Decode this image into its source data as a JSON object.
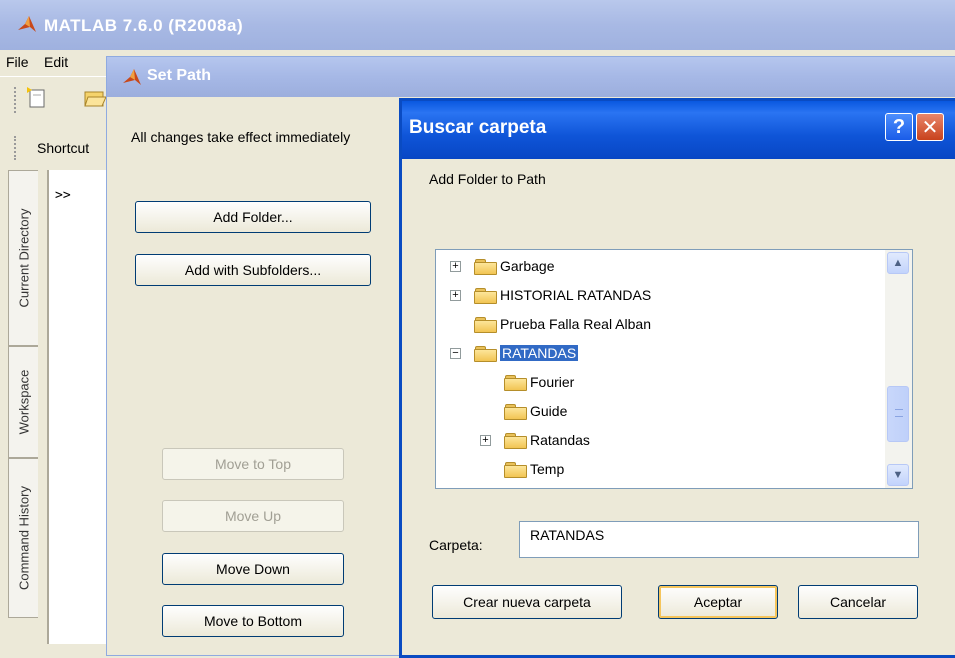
{
  "main_window": {
    "title": "MATLAB  7.6.0 (R2008a)",
    "menu": [
      "File",
      "Edit"
    ],
    "shortcut_label": "Shortcut",
    "side_tabs": [
      "Current Directory",
      "Workspace",
      "Command History"
    ],
    "prompt": ">>"
  },
  "set_path": {
    "title": "Set Path",
    "info": "All changes take effect immediately",
    "buttons": {
      "add_folder": "Add Folder...",
      "add_subfolders": "Add with Subfolders...",
      "move_top": "Move to Top",
      "move_up": "Move Up",
      "move_down": "Move Down",
      "move_bottom": "Move to Bottom"
    }
  },
  "browse": {
    "title": "Buscar carpeta",
    "help": "?",
    "close": "✕",
    "instruction": "Add Folder to Path",
    "tree": [
      {
        "label": "Garbage",
        "expander": "+",
        "level": 0
      },
      {
        "label": "HISTORIAL RATANDAS",
        "expander": "+",
        "level": 0
      },
      {
        "label": "Prueba Falla Real Alban",
        "expander": "",
        "level": 0
      },
      {
        "label": "RATANDAS",
        "expander": "−",
        "level": 0,
        "selected": true
      },
      {
        "label": "Fourier",
        "expander": "",
        "level": 1
      },
      {
        "label": "Guide",
        "expander": "",
        "level": 1
      },
      {
        "label": "Ratandas",
        "expander": "+",
        "level": 1
      },
      {
        "label": "Temp",
        "expander": "",
        "level": 1
      }
    ],
    "folder_label": "Carpeta:",
    "folder_value": "RATANDAS",
    "buttons": {
      "new_folder": "Crear nueva carpeta",
      "ok": "Aceptar",
      "cancel": "Cancelar"
    }
  }
}
